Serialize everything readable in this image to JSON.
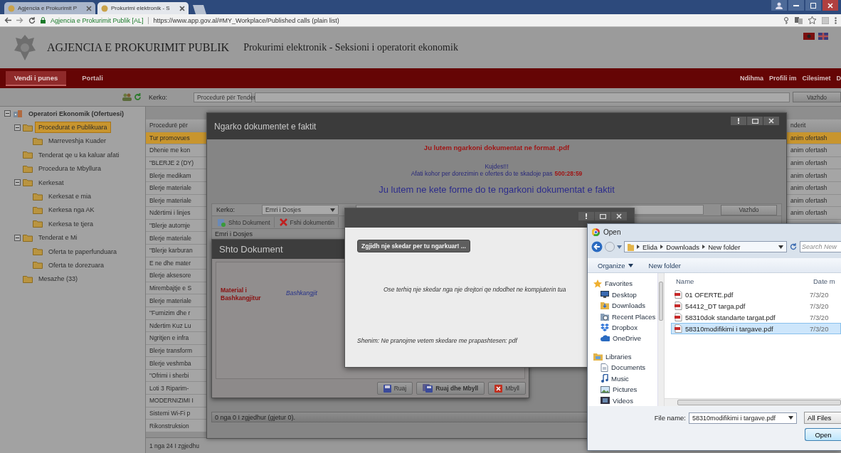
{
  "browser": {
    "tabs": [
      {
        "label": "Agjencia e Prokurimit P",
        "selected": false
      },
      {
        "label": "Prokurimi elektronik - S",
        "selected": true
      }
    ],
    "address": {
      "site": "Agjencia e Prokurimit Publik [AL]",
      "url": "https://www.app.gov.al/#MY_Workplace/Published calls (plain list)"
    }
  },
  "header": {
    "agency": "AGJENCIA E PROKURIMIT PUBLIK",
    "subtitle": "Prokurimi elektronik - Seksioni i operatorit ekonomik"
  },
  "nav": {
    "tabs": [
      {
        "label": "Vendi i punes",
        "selected": true
      },
      {
        "label": "Portali",
        "selected": false
      }
    ],
    "links": [
      "Ndihma",
      "Profili im",
      "Cilesimet",
      "D"
    ]
  },
  "search": {
    "label": "Kerko:",
    "scope": "Procedurë për Tender",
    "button": "Vazhdo"
  },
  "sidebar": {
    "items": [
      {
        "label": "Operatori Ekonomik (Ofertuesi)",
        "kind": "organization",
        "selected": false,
        "expanded": true,
        "children": [
          {
            "label": "Procedurat e Publikuara",
            "kind": "folder",
            "selected": true,
            "expanded": true,
            "children": [
              {
                "label": "Marreveshja Kuader",
                "kind": "folder",
                "selected": false
              }
            ]
          },
          {
            "label": "Tenderat qe u ka kaluar afati",
            "kind": "folder",
            "selected": false
          },
          {
            "label": "Procedura te Mbyllura",
            "kind": "folder",
            "selected": false
          },
          {
            "label": "Kerkesat",
            "kind": "folder",
            "selected": false,
            "expanded": true,
            "children": [
              {
                "label": "Kerkesat e mia",
                "kind": "folder",
                "selected": false
              },
              {
                "label": "Kerkesa nga AK",
                "kind": "folder",
                "selected": false
              },
              {
                "label": "Kerkesa te tjera",
                "kind": "folder",
                "selected": false
              }
            ]
          },
          {
            "label": "Tenderat e Mi",
            "kind": "folder",
            "selected": false,
            "expanded": true,
            "children": [
              {
                "label": "Oferta te paperfunduara",
                "kind": "folder",
                "selected": false
              },
              {
                "label": "Oferta te dorezuara",
                "kind": "folder",
                "selected": false
              }
            ]
          },
          {
            "label": "Mesazhe (33)",
            "kind": "folder",
            "selected": false
          }
        ]
      }
    ]
  },
  "table": {
    "columns": [
      "Procedurë për",
      "nderit"
    ],
    "rows": [
      {
        "cells": [
          "Tur promovues",
          "anim ofertash"
        ],
        "selected": true
      },
      {
        "cells": [
          "Dhenie me kon",
          "anim ofertash"
        ],
        "selected": false
      },
      {
        "cells": [
          "\"BLERJE 2 (DY)",
          "anim ofertash"
        ],
        "selected": false
      },
      {
        "cells": [
          "Blerje medikam",
          "anim ofertash"
        ],
        "selected": false
      },
      {
        "cells": [
          "Blerje materiale",
          "anim ofertash"
        ],
        "selected": false
      },
      {
        "cells": [
          "Blerje materiale",
          "anim ofertash"
        ],
        "selected": false
      },
      {
        "cells": [
          "Ndërtimi i linjes",
          "anim ofertash"
        ],
        "selected": false
      },
      {
        "cells": [
          "\"Blerje automje"
        ],
        "selected": false
      },
      {
        "cells": [
          "Blerje materiale"
        ],
        "selected": false
      },
      {
        "cells": [
          "\"Blerje karburan"
        ],
        "selected": false
      },
      {
        "cells": [
          "E ne dhe mater"
        ],
        "selected": false
      },
      {
        "cells": [
          "Blerje aksesore"
        ],
        "selected": false
      },
      {
        "cells": [
          "Mirembajtje e S"
        ],
        "selected": false
      },
      {
        "cells": [
          "Blerje materiale"
        ],
        "selected": false
      },
      {
        "cells": [
          "\"Furnizim dhe r"
        ],
        "selected": false
      },
      {
        "cells": [
          "Ndertim Kuz Lu"
        ],
        "selected": false
      },
      {
        "cells": [
          "Ngritjen e infra"
        ],
        "selected": false
      },
      {
        "cells": [
          "Blerje transform"
        ],
        "selected": false
      },
      {
        "cells": [
          "Blerje veshmba"
        ],
        "selected": false
      },
      {
        "cells": [
          "\"Ofrimi i sherbi"
        ],
        "selected": false
      },
      {
        "cells": [
          "Loti 3 Riparim-"
        ],
        "selected": false
      },
      {
        "cells": [
          "MODERNIZIMI I"
        ],
        "selected": false
      },
      {
        "cells": [
          "Sistemi Wi-Fi p"
        ],
        "selected": false
      },
      {
        "cells": [
          "Rikonstruksion"
        ],
        "selected": false
      }
    ],
    "footer": "1 nga 24 I zgjedhu"
  },
  "upload_dialog": {
    "title": "Ngarko dokumentet e faktit",
    "notice": "Ju lutem ngarkoni dokumentat ne format .pdf",
    "warning": "Kujdes!!!",
    "deadline_text": "Afati kohor per dorezimin e ofertes do te skadoje pas",
    "deadline_time": "500:28:59",
    "instruction": "Ju lutem ne kete forme do te ngarkoni dokumentat e faktit",
    "search": {
      "label": "Kerko:",
      "scope": "Emri i Dosjes",
      "button": "Vazhdo"
    },
    "toolbar": [
      {
        "label": "Shto Dokument",
        "kind": "add"
      },
      {
        "label": "Fshi dokumentin",
        "kind": "delete"
      }
    ],
    "column": "Emri i Dosjes",
    "footer": "0 nga 0 I zgjedhur (gjetur 0)."
  },
  "add_dialog": {
    "title": "Shto Dokument",
    "field_label": "Material i Bashkangjitur",
    "attach_link": "Bashkangjit",
    "buttons": [
      {
        "label": "Ruaj",
        "kind": "save"
      },
      {
        "label": "Ruaj dhe Mbyll",
        "kind": "saveclose"
      },
      {
        "label": "Mbyll",
        "kind": "close"
      }
    ]
  },
  "file_picker": {
    "choose_button": "Zgjidh nje skedar per tu ngarkuar! ...",
    "drop_hint": "Ose terhiq nje skedar nga nje drejtori qe ndodhet ne kompjuterin tua",
    "note": "Shenim: Ne pranojme vetem skedare me prapashtesen: pdf"
  },
  "open_dialog": {
    "title": "Open",
    "path": [
      "Elida",
      "Downloads",
      "New folder"
    ],
    "search_placeholder": "Search New",
    "toolbar": [
      "Organize",
      "New folder"
    ],
    "nav": [
      {
        "label": "Favorites",
        "kind": "star"
      },
      {
        "label": "Desktop",
        "kind": "desktop"
      },
      {
        "label": "Downloads",
        "kind": "downloads"
      },
      {
        "label": "Recent Places",
        "kind": "recent"
      },
      {
        "label": "Dropbox",
        "kind": "dropbox"
      },
      {
        "label": "OneDrive",
        "kind": "cloud"
      },
      {
        "label": "Libraries",
        "kind": "library"
      },
      {
        "label": "Documents",
        "kind": "documents"
      },
      {
        "label": "Music",
        "kind": "music"
      },
      {
        "label": "Pictures",
        "kind": "pictures"
      },
      {
        "label": "Videos",
        "kind": "videos"
      }
    ],
    "columns": [
      "Name",
      "Date m"
    ],
    "files": [
      {
        "name": "01 OFERTE.pdf",
        "date": "7/3/20",
        "selected": false
      },
      {
        "name": "54412_DT targa.pdf",
        "date": "7/3/20",
        "selected": false
      },
      {
        "name": "58310dok standarte targat.pdf",
        "date": "7/3/20",
        "selected": false
      },
      {
        "name": "58310modifikimi i targave.pdf",
        "date": "7/3/20",
        "selected": true
      }
    ],
    "file_name_label": "File name:",
    "file_name": "58310modifikimi i targave.pdf",
    "filter": "All Files",
    "open_button": "Open"
  }
}
